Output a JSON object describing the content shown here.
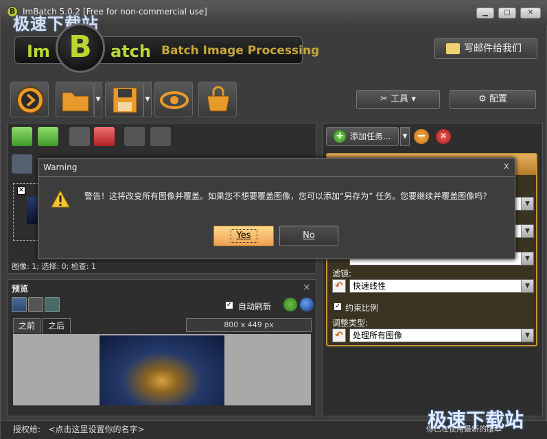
{
  "window": {
    "app_icon_letter": "B",
    "title": "ImBatch 5.0.2 [Free for non-commercial use]",
    "watermark_top": "极速下载站",
    "minimize": "▁",
    "maximize": "□",
    "close": "✕"
  },
  "brand": {
    "im": "Im",
    "b": "B",
    "atch": "atch",
    "subtitle": "Batch Image Processing"
  },
  "header": {
    "mail_button": "写邮件给我们",
    "tools_button": "工具",
    "config_button": "配置"
  },
  "toolbar": {
    "arrow": "▼"
  },
  "images_panel": {
    "stats": "图像: 1; 选择: 0; 检查: 1"
  },
  "preview": {
    "title": "预览",
    "close": "×",
    "auto_refresh": "自动刷新",
    "auto_refresh_checked": true,
    "tab_before": "之前",
    "tab_after": "之后",
    "dimensions": "800 x 449 px"
  },
  "tasks": {
    "add_task": "添加任务...",
    "filter_label": "滤镜:",
    "filter_value": "快速线性",
    "keep_ratio": "约束比例",
    "keep_ratio_checked": true,
    "adjust_label": "调整类型:",
    "adjust_value": "处理所有图像"
  },
  "statusbar": {
    "license_label": "授权给:",
    "license_value": "<点击这里设置你的名字>",
    "version_status": "你已在使用最新的版本",
    "watermark_bottom": "极速下载站"
  },
  "dialog": {
    "title": "Warning",
    "close": "x",
    "message": "警告！这将改变所有图像并覆盖。如果您不想要覆盖图像，您可以添加“另存为” 任务。您要继续并覆盖图像吗？",
    "yes": "Yes",
    "no": "No"
  },
  "colors": {
    "accent_orange": "#c9963a",
    "brand_green": "#b8d832",
    "brand_gold": "#c8a838"
  }
}
